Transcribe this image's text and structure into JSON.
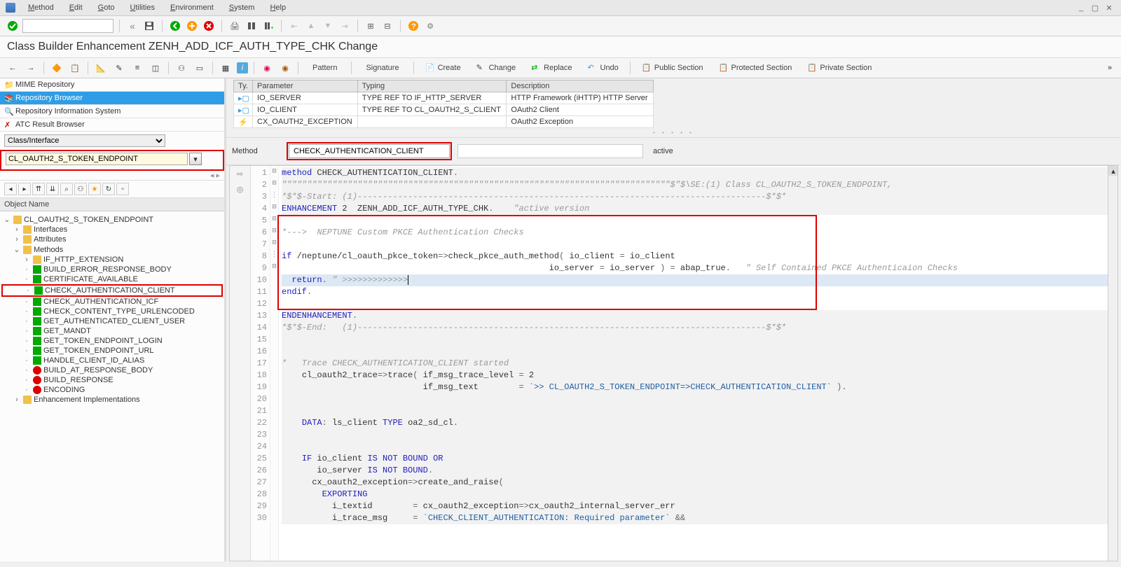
{
  "menubar": {
    "items": [
      "Method",
      "Edit",
      "Goto",
      "Utilities",
      "Environment",
      "System",
      "Help"
    ]
  },
  "title": "Class Builder Enhancement ZENH_ADD_ICF_AUTH_TYPE_CHK Change",
  "toolbar2": {
    "pattern": "Pattern",
    "signature": "Signature",
    "create": "Create",
    "change": "Change",
    "replace": "Replace",
    "undo": "Undo",
    "public": "Public Section",
    "protected": "Protected Section",
    "private": "Private Section"
  },
  "left": {
    "nav": {
      "mime": "MIME Repository",
      "repo": "Repository Browser",
      "ris": "Repository Information System",
      "atc": "ATC Result Browser"
    },
    "selector_label": "Class/Interface",
    "class_input": "CL_OAUTH2_S_TOKEN_ENDPOINT",
    "tree_header": "Object Name",
    "tree": {
      "root": "CL_OAUTH2_S_TOKEN_ENDPOINT",
      "folders": {
        "interfaces": "Interfaces",
        "attributes": "Attributes",
        "methods": "Methods",
        "enh": "Enhancement Implementations"
      },
      "methods": [
        "IF_HTTP_EXTENSION",
        "BUILD_ERROR_RESPONSE_BODY",
        "CERTIFICATE_AVAILABLE",
        "CHECK_AUTHENTICATION_CLIENT",
        "CHECK_AUTHENTICATION_ICF",
        "CHECK_CONTENT_TYPE_URLENCODED",
        "GET_AUTHENTICATED_CLIENT_USER",
        "GET_MANDT",
        "GET_TOKEN_ENDPOINT_LOGIN",
        "GET_TOKEN_ENDPOINT_URL",
        "HANDLE_CLIENT_ID_ALIAS",
        "BUILD_AT_RESPONSE_BODY",
        "BUILD_RESPONSE",
        "ENCODING"
      ]
    }
  },
  "params": {
    "headers": {
      "ty": "Ty.",
      "param": "Parameter",
      "typing": "Typing",
      "desc": "Description"
    },
    "rows": [
      {
        "kind": "import",
        "param": "IO_SERVER",
        "typing": "TYPE REF TO IF_HTTP_SERVER",
        "desc": "HTTP Framework (iHTTP) HTTP Server"
      },
      {
        "kind": "import",
        "param": "IO_CLIENT",
        "typing": "TYPE REF TO CL_OAUTH2_S_CLIENT",
        "desc": "OAuth2 Client"
      },
      {
        "kind": "exc",
        "param": "CX_OAUTH2_EXCEPTION",
        "typing": "",
        "desc": "OAuth2 Exception"
      }
    ]
  },
  "method_row": {
    "label": "Method",
    "name": "CHECK_AUTHENTICATION_CLIENT",
    "status": "active"
  },
  "code": {
    "lines": [
      {
        "n": 1,
        "fold": "⊟",
        "cls": "enh-bg",
        "html": "<span class='kw'>method</span> <span class='id'>CHECK_AUTHENTICATION_CLIENT</span><span class='op'>.</span>"
      },
      {
        "n": 2,
        "fold": "⊟",
        "cls": "enh-bg",
        "html": "<span class='cm'>\"\"\"\"\"\"\"\"\"\"\"\"\"\"\"\"\"\"\"\"\"\"\"\"\"\"\"\"\"\"\"\"\"\"\"\"\"\"\"\"\"\"\"\"\"\"\"\"\"\"\"\"\"\"\"\"\"\"\"\"\"\"\"\"\"\"\"\"\"\"\"\"\"\"\"\"\"$\"$\\SE:(1) Class CL_OAUTH2_S_TOKEN_ENDPOINT,</span>"
      },
      {
        "n": 3,
        "fold": "⋮",
        "cls": "enh-bg",
        "html": "<span class='cm'>*$*$-Start: (1)---------------------------------------------------------------------------------$*$*</span>"
      },
      {
        "n": 4,
        "fold": "⊟",
        "cls": "enh-bg",
        "html": "<span class='kw'>ENHANCEMENT</span> <span class='id'>2</span>  <span class='id'>ZENH_ADD_ICF_AUTH_TYPE_CHK</span><span class='op'>.</span>    <span class='cm'>\"active version</span>"
      },
      {
        "n": 5,
        "fold": "",
        "cls": "",
        "html": ""
      },
      {
        "n": 6,
        "fold": "",
        "cls": "",
        "html": "<span class='cm'>*---&gt;  NEPTUNE Custom PKCE Authentication Checks</span>"
      },
      {
        "n": 7,
        "fold": "",
        "cls": "",
        "html": ""
      },
      {
        "n": 8,
        "fold": "⊟",
        "cls": "",
        "html": "<span class='kw'>if</span> <span class='id'>/neptune/cl_oauth_pkce_token</span><span class='op'>=&gt;</span><span class='id'>check_pkce_auth_method</span><span class='op'>(</span> io_client <span class='op'>=</span> io_client"
      },
      {
        "n": 9,
        "fold": "",
        "cls": "",
        "html": "                                                     io_server <span class='op'>=</span> io_server <span class='op'>)</span> <span class='op'>=</span> abap_true<span class='op'>.</span>   <span class='cm'>\" Self Contained PKCE Authenticaion Checks</span>"
      },
      {
        "n": 10,
        "fold": "",
        "cls": "cursor-line",
        "html": "  <span class='kw'>return</span><span class='op'>.</span> <span class='cm'>\" &gt;&gt;&gt;&gt;&gt;&gt;&gt;&gt;&gt;&gt;&gt;&gt;&gt;</span><span style='border-left:1px solid #000;'></span>"
      },
      {
        "n": 11,
        "fold": "",
        "cls": "",
        "html": "<span class='kw'>endif</span><span class='op'>.</span>"
      },
      {
        "n": 12,
        "fold": "",
        "cls": "",
        "html": ""
      },
      {
        "n": 13,
        "fold": "⊟",
        "cls": "enh-bg",
        "html": "<span class='kw'>ENDENHANCEMENT</span><span class='op'>.</span>"
      },
      {
        "n": 14,
        "fold": "",
        "cls": "enh-bg",
        "html": "<span class='cm'>*$*$-End:   (1)---------------------------------------------------------------------------------$*$*</span>"
      },
      {
        "n": 15,
        "fold": "",
        "cls": "enh-bg",
        "html": ""
      },
      {
        "n": 16,
        "fold": "",
        "cls": "enh-bg",
        "html": ""
      },
      {
        "n": 17,
        "fold": "⊟",
        "cls": "enh-bg",
        "html": "<span class='cm'>*   Trace CHECK_AUTHENTICATION_CLIENT started</span>"
      },
      {
        "n": 18,
        "fold": "",
        "cls": "enh-bg",
        "html": "    <span class='id'>cl_oauth2_trace</span><span class='op'>=&gt;</span><span class='id'>trace</span><span class='op'>(</span> if_msg_trace_level <span class='op'>=</span> <span class='id'>2</span>"
      },
      {
        "n": 19,
        "fold": "",
        "cls": "enh-bg",
        "html": "                            if_msg_text        <span class='op'>=</span> <span class='st'>`&gt;&gt; CL_OAUTH2_S_TOKEN_ENDPOINT=&gt;CHECK_AUTHENTICATION_CLIENT`</span> <span class='op'>).</span>"
      },
      {
        "n": 20,
        "fold": "⋮",
        "cls": "enh-bg",
        "html": ""
      },
      {
        "n": 21,
        "fold": "",
        "cls": "enh-bg",
        "html": ""
      },
      {
        "n": 22,
        "fold": "",
        "cls": "enh-bg",
        "html": "    <span class='kw'>DATA</span><span class='op'>:</span> ls_client <span class='kw'>TYPE</span> <span class='id'>oa2_sd_cl</span><span class='op'>.</span>"
      },
      {
        "n": 23,
        "fold": "",
        "cls": "enh-bg",
        "html": ""
      },
      {
        "n": 24,
        "fold": "",
        "cls": "enh-bg",
        "html": ""
      },
      {
        "n": 25,
        "fold": "⊟",
        "cls": "enh-bg",
        "html": "    <span class='kw'>IF</span> io_client <span class='kw'>IS NOT BOUND</span> <span class='kw'>OR</span>"
      },
      {
        "n": 26,
        "fold": "",
        "cls": "enh-bg",
        "html": "       io_server <span class='kw'>IS NOT BOUND</span><span class='op'>.</span>"
      },
      {
        "n": 27,
        "fold": "",
        "cls": "enh-bg",
        "html": "      <span class='id'>cx_oauth2_exception</span><span class='op'>=&gt;</span><span class='id'>create_and_raise</span><span class='op'>(</span>"
      },
      {
        "n": 28,
        "fold": "",
        "cls": "enh-bg",
        "html": "        <span class='kw'>EXPORTING</span>"
      },
      {
        "n": 29,
        "fold": "",
        "cls": "enh-bg",
        "html": "          i_textid        <span class='op'>=</span> cx_oauth2_exception<span class='op'>=&gt;</span>cx_oauth2_internal_server_err"
      },
      {
        "n": 30,
        "fold": "",
        "cls": "enh-bg",
        "html": "          i_trace_msg     <span class='op'>=</span> <span class='st'>`CHECK_CLIENT_AUTHENTICATION: Required parameter`</span> <span class='op'>&amp;&amp;</span>"
      }
    ]
  }
}
